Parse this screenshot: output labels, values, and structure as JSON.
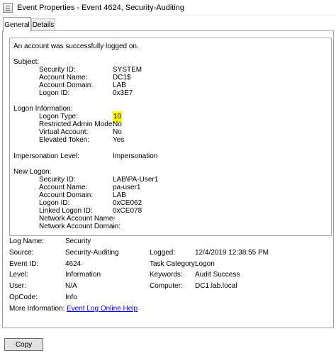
{
  "window": {
    "title": "Event Properties - Event 4624, Security-Auditing"
  },
  "tabs": [
    {
      "label": "General"
    },
    {
      "label": "Details"
    }
  ],
  "message": {
    "intro": "An account was successfully logged on.",
    "subject_header": "Subject:",
    "subject": [
      {
        "label": "Security ID:",
        "value": "SYSTEM"
      },
      {
        "label": "Account Name:",
        "value": "DC1$"
      },
      {
        "label": "Account Domain:",
        "value": "LAB"
      },
      {
        "label": "Logon ID:",
        "value": "0x3E7"
      }
    ],
    "logon_info_header": "Logon Information:",
    "logon_info": [
      {
        "label": "Logon Type:",
        "value": "10"
      },
      {
        "label": "Restricted Admin Mode:",
        "value": "No"
      },
      {
        "label": "Virtual Account:",
        "value": "No"
      },
      {
        "label": "Elevated Token:",
        "value": "Yes"
      }
    ],
    "impersonation_label": "Impersonation Level:",
    "impersonation_value": "Impersonation",
    "new_logon_header": "New Logon:",
    "new_logon": [
      {
        "label": "Security ID:",
        "value": "LAB\\PA-User1"
      },
      {
        "label": "Account Name:",
        "value": "pa-user1"
      },
      {
        "label": "Account Domain:",
        "value": "LAB"
      },
      {
        "label": "Logon ID:",
        "value": "0xCE062"
      },
      {
        "label": "Linked Logon ID:",
        "value": "0xCE078"
      },
      {
        "label": "Network Account Name:",
        "value": "-"
      },
      {
        "label": "Network Account Domain:",
        "value": "-"
      }
    ]
  },
  "summary": {
    "log_name_label": "Log Name:",
    "log_name": "Security",
    "source_label": "Source:",
    "source": "Security-Auditing",
    "logged_label": "Logged:",
    "logged": "12/4/2019 12:38:55 PM",
    "event_id_label": "Event ID:",
    "event_id": "4624",
    "task_category_label": "Task Category:",
    "task_category": "Logon",
    "level_label": "Level:",
    "level": "Information",
    "keywords_label": "Keywords:",
    "keywords": "Audit Success",
    "user_label": "User:",
    "user": "N/A",
    "computer_label": "Computer:",
    "computer": "DC1.lab.local",
    "opcode_label": "OpCode:",
    "opcode": "Info",
    "more_info_label": "More Information:",
    "more_info_link": "Event Log Online Help"
  },
  "footer": {
    "copy_label": "Copy"
  },
  "colors": {
    "highlight": "#ffff00",
    "link": "#0000ee"
  }
}
